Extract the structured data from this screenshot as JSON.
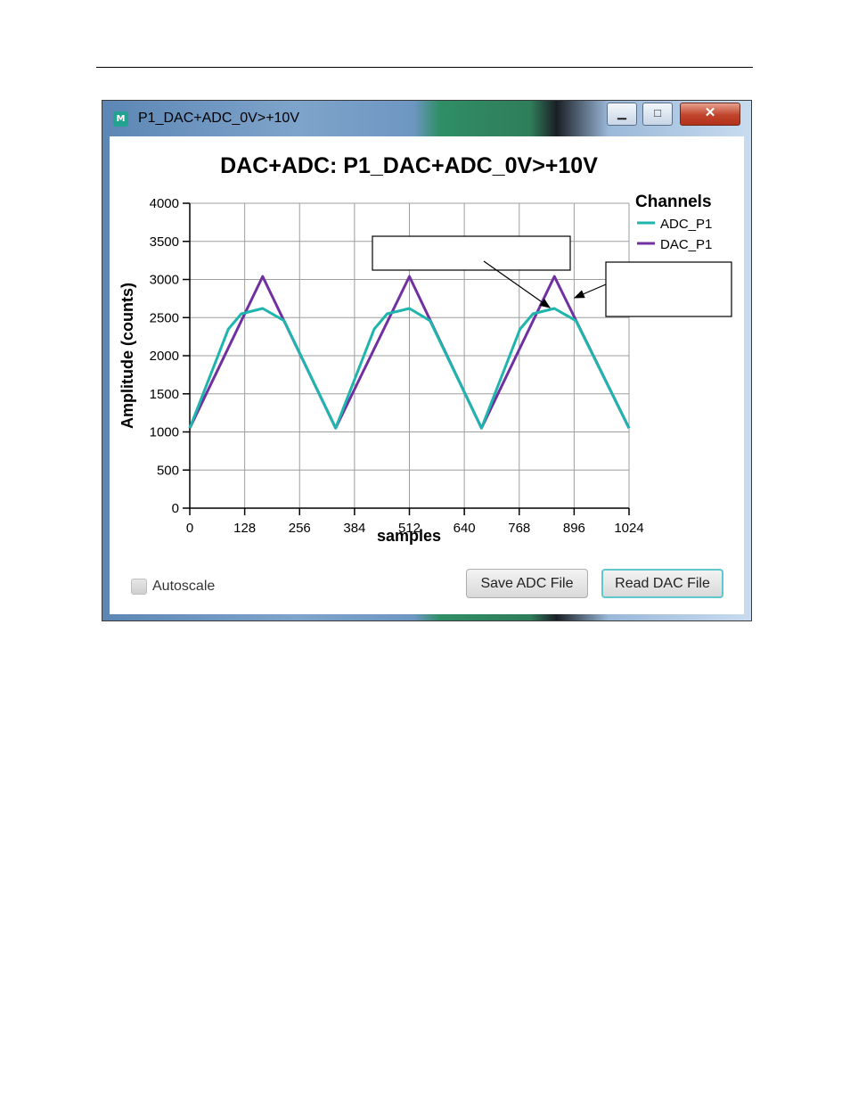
{
  "window": {
    "title": "P1_DAC+ADC_0V>+10V",
    "icon_text": "M",
    "controls": {
      "minimize": "▁",
      "maximize": "□",
      "close": "✕"
    }
  },
  "controls": {
    "autoscale_label": "Autoscale",
    "autoscale_checked": false,
    "save_button": "Save ADC File",
    "read_button": "Read DAC File"
  },
  "colors": {
    "adc": "#1fb5ad",
    "dac": "#7030a0",
    "grid": "#9e9e9e",
    "accent": "#5fc8cf"
  },
  "chart_data": {
    "type": "line",
    "title": "DAC+ADC: P1_DAC+ADC_0V>+10V",
    "xlabel": "samples",
    "ylabel": "Amplitude (counts)",
    "xlim": [
      0,
      1024
    ],
    "ylim": [
      0,
      4000
    ],
    "xticks": [
      0,
      128,
      256,
      384,
      512,
      640,
      768,
      896,
      1024
    ],
    "yticks": [
      0,
      500,
      1000,
      1500,
      2000,
      2500,
      3000,
      3500,
      4000
    ],
    "grid": true,
    "legend": {
      "title": "Channels",
      "placement": "top-right"
    },
    "series": [
      {
        "name": "ADC_P1",
        "color": "#1fb5ad",
        "x": [
          0,
          90,
          120,
          170,
          220,
          340,
          430,
          460,
          512,
          560,
          680,
          770,
          800,
          850,
          900,
          1024
        ],
        "y": [
          1050,
          2350,
          2550,
          2620,
          2460,
          1050,
          2350,
          2550,
          2620,
          2460,
          1050,
          2350,
          2550,
          2620,
          2460,
          1050
        ]
      },
      {
        "name": "DAC_P1",
        "color": "#7030a0",
        "x": [
          0,
          170,
          340,
          512,
          680,
          850,
          1024
        ],
        "y": [
          1050,
          3040,
          1050,
          3040,
          1050,
          3040,
          1050
        ]
      }
    ]
  }
}
